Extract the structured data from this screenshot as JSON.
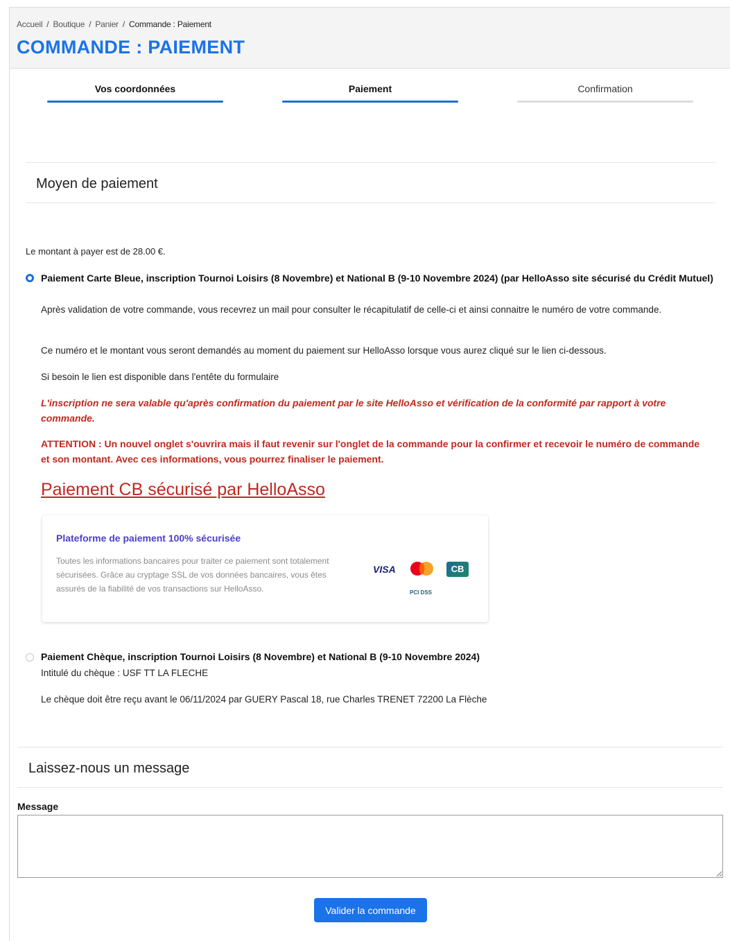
{
  "breadcrumb": {
    "items": [
      "Accueil",
      "Boutique",
      "Panier"
    ],
    "current": "Commande : Paiement",
    "separator": "/"
  },
  "page_title": "COMMANDE : PAIEMENT",
  "steps": [
    {
      "label": "Vos coordonnées",
      "state": "done"
    },
    {
      "label": "Paiement",
      "state": "active"
    },
    {
      "label": "Confirmation",
      "state": "pending"
    }
  ],
  "payment_section": {
    "title": "Moyen de paiement",
    "amount_text": "Le montant à payer est de 28.00 €."
  },
  "option_card": {
    "selected": true,
    "title": "Paiement Carte Bleue, inscription Tournoi Loisirs (8 Novembre) et National B (9-10 Novembre 2024) (par HelloAsso site sécurisé du Crédit Mutuel)",
    "text1": "Après validation de votre commande, vous recevrez un mail pour consulter le récapitulatif de celle-ci et ainsi connaitre le numéro de votre commande.",
    "text2": "Ce numéro et le montant vous seront demandés au moment du paiement sur HelloAsso lorsque vous aurez cliqué sur le lien ci-dessous.",
    "text3": "Si besoin le lien est disponible dans l'entête du formulaire",
    "warning_italic": "L'inscription ne sera valable qu'après confirmation du paiement par le site HelloAsso et vérification de la conformité par rapport à votre commande.",
    "warning": "ATTENTION : Un nouvel onglet s'ouvrira mais il faut revenir sur l'onglet de la commande pour la confirmer et recevoir le numéro de commande et son montant. Avec ces informations, vous pourrez finaliser le paiement.",
    "link_text": "Paiement CB sécurisé par HelloAsso",
    "secure_box": {
      "title": "Plateforme de paiement 100% sécurisée",
      "text": "Toutes les informations bancaires pour traiter ce paiement sont totalement sécurisées. Grâce au cryptage SSL de vos données bancaires, vous êtes assurés de la fiabilité de vos transactions sur HelloAsso.",
      "logos": {
        "visa": "VISA",
        "cb": "CB",
        "pci": "PCI DSS"
      }
    }
  },
  "option_cheque": {
    "selected": false,
    "title": "Paiement Chèque, inscription Tournoi Loisirs (8 Novembre) et National B (9-10 Novembre 2024)",
    "text1": "Intitulé du chèque : USF TT LA FLECHE",
    "text2": "Le chèque doit être reçu avant le 06/11/2024 par GUERY Pascal 18, rue Charles TRENET 72200 La Flèche"
  },
  "message_section": {
    "title": "Laissez-nous un message",
    "label": "Message",
    "value": ""
  },
  "submit_label": "Valider la commande",
  "colors": {
    "accent": "#1a73e8",
    "warning": "#c0281e",
    "secure_title": "#4b3fc9"
  }
}
